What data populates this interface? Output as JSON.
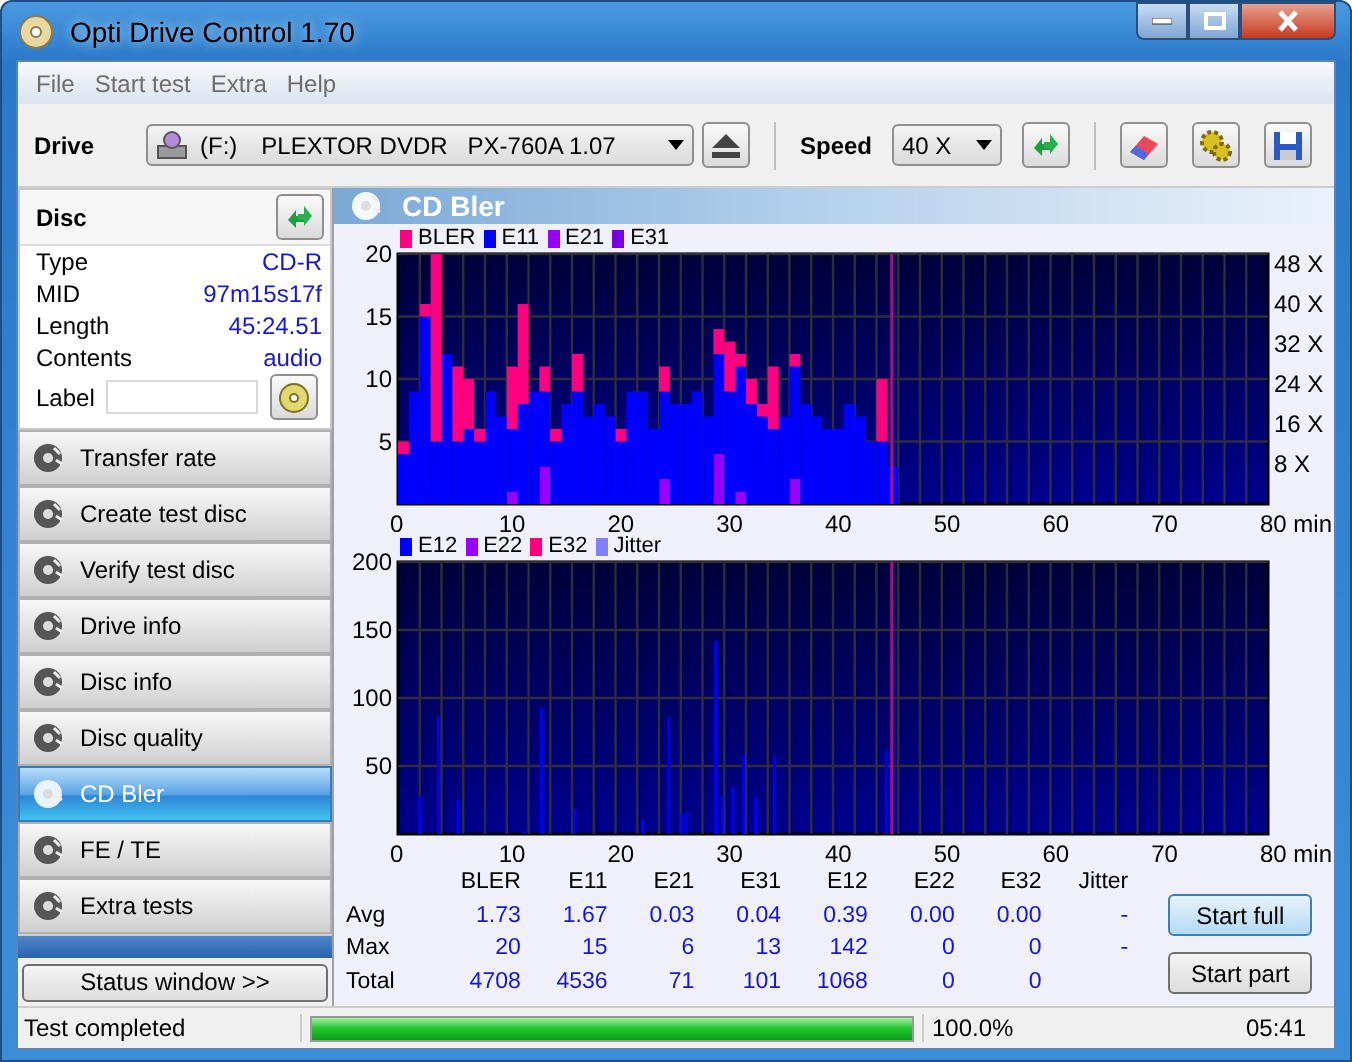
{
  "window": {
    "title": "Opti Drive Control 1.70"
  },
  "menu": [
    "File",
    "Start test",
    "Extra",
    "Help"
  ],
  "toolbar": {
    "drive_label": "Drive",
    "drive_letter": "(F:)",
    "drive_name": "PLEXTOR DVDR   PX-760A 1.07",
    "speed_label": "Speed",
    "speed": "40 X"
  },
  "disc": {
    "title": "Disc",
    "fields": [
      {
        "label": "Type",
        "value": "CD-R"
      },
      {
        "label": "MID",
        "value": "97m15s17f"
      },
      {
        "label": "Length",
        "value": "45:24.51"
      },
      {
        "label": "Contents",
        "value": "audio"
      }
    ],
    "label_caption": "Label"
  },
  "nav": [
    {
      "label": "Transfer rate",
      "selected": false
    },
    {
      "label": "Create test disc",
      "selected": false
    },
    {
      "label": "Verify test disc",
      "selected": false
    },
    {
      "label": "Drive info",
      "selected": false
    },
    {
      "label": "Disc info",
      "selected": false
    },
    {
      "label": "Disc quality",
      "selected": false
    },
    {
      "label": "CD Bler",
      "selected": true
    },
    {
      "label": "FE / TE",
      "selected": false
    },
    {
      "label": "Extra tests",
      "selected": false
    }
  ],
  "status_window_button": "Status window >>",
  "panel": {
    "title": "CD Bler",
    "top_chart": {
      "chart_data": {
        "type": "bar",
        "xlim": [
          0,
          80
        ],
        "ylim": [
          0,
          20
        ],
        "x": [
          0,
          1,
          2,
          3,
          4,
          5,
          6,
          7,
          8,
          9,
          10,
          11,
          12,
          13,
          14,
          15,
          16,
          17,
          18,
          19,
          20,
          21,
          22,
          23,
          24,
          25,
          26,
          27,
          28,
          29,
          30,
          31,
          32,
          33,
          34,
          35,
          36,
          37,
          38,
          39,
          40,
          41,
          42,
          43,
          44,
          45
        ],
        "series": [
          {
            "name": "BLER",
            "color": "#ff0080",
            "values": [
              1,
              0,
              1,
              15,
              0,
              6,
              4,
              1,
              0,
              0,
              5,
              8,
              0,
              2,
              1,
              0,
              3,
              0,
              0,
              0,
              1,
              0,
              0,
              0,
              2,
              0,
              0,
              0,
              0,
              2,
              4,
              1,
              2,
              1,
              5,
              0,
              1,
              0,
              0,
              0,
              0,
              0,
              0,
              0,
              5,
              0
            ]
          },
          {
            "name": "E11",
            "color": "#0000ff",
            "values": [
              4,
              9,
              15,
              5,
              12,
              5,
              6,
              5,
              9,
              7,
              5,
              8,
              9,
              6,
              5,
              8,
              9,
              7,
              8,
              7,
              5,
              9,
              9,
              6,
              7,
              8,
              8,
              9,
              7,
              8,
              9,
              10,
              8,
              7,
              6,
              7,
              9,
              8,
              7,
              6,
              6,
              8,
              7,
              5,
              5,
              3
            ]
          },
          {
            "name": "E21",
            "color": "#9900ff",
            "values": [
              0,
              0,
              0,
              0,
              0,
              0,
              0,
              0,
              0,
              0,
              1,
              0,
              0,
              3,
              0,
              0,
              0,
              0,
              0,
              0,
              0,
              0,
              0,
              0,
              2,
              0,
              0,
              0,
              0,
              4,
              0,
              1,
              0,
              0,
              0,
              0,
              2,
              0,
              0,
              0,
              0,
              0,
              0,
              0,
              0,
              0
            ]
          },
          {
            "name": "E31",
            "color": "#7a00e0",
            "values": [
              0,
              0,
              0,
              0,
              0,
              0,
              0,
              0,
              0,
              0,
              0,
              0,
              0,
              0,
              0,
              0,
              0,
              0,
              0,
              0,
              0,
              0,
              0,
              0,
              0,
              0,
              0,
              0,
              0,
              0,
              0,
              0,
              0,
              0,
              0,
              0,
              0,
              0,
              0,
              0,
              0,
              0,
              0,
              0,
              0,
              0
            ]
          }
        ],
        "stacked": true,
        "grid": true,
        "y2lim": [
          0,
          50
        ],
        "xticks": [
          0,
          10,
          20,
          30,
          40,
          50,
          60,
          70,
          {
            "value": 80,
            "label": "80 min"
          }
        ],
        "yticks": [
          5,
          10,
          15,
          20
        ],
        "y2ticks": [
          {
            "value": 8,
            "label": "8 X"
          },
          {
            "value": 16,
            "label": "16 X"
          },
          {
            "value": 24,
            "label": "24 X"
          },
          {
            "value": 32,
            "label": "32 X"
          },
          {
            "value": 40,
            "label": "40 X"
          },
          {
            "value": 48,
            "label": "48 X"
          }
        ],
        "ref_lines": [
          {
            "axis": "x",
            "value": 45.4,
            "color": "#a0108a"
          }
        ]
      }
    },
    "bottom_chart": {
      "chart_data": {
        "type": "bar",
        "xlim": [
          0,
          80
        ],
        "ylim": [
          0,
          200
        ],
        "x": [
          2,
          3.7,
          5.5,
          11.6,
          13.2,
          16.2,
          22.5,
          24.9,
          26.1,
          26.5,
          29.2,
          29.8,
          30.8,
          31.8,
          32.9,
          34.6,
          44.9
        ],
        "series": [
          {
            "name": "E12",
            "color": "#0000ff",
            "values": [
              28,
              86,
              25,
              2,
              93,
              18,
              10,
              86,
              15,
              16,
              142,
              28,
              34,
              58,
              26,
              58,
              62
            ]
          },
          {
            "name": "E22",
            "color": "#9900ff",
            "values": [
              0,
              0,
              0,
              0,
              0,
              0,
              0,
              0,
              0,
              0,
              0,
              0,
              0,
              0,
              0,
              0,
              0
            ]
          },
          {
            "name": "E32",
            "color": "#ff0080",
            "values": [
              0,
              0,
              0,
              0,
              0,
              0,
              0,
              0,
              0,
              0,
              0,
              0,
              0,
              0,
              0,
              0,
              0
            ]
          },
          {
            "name": "Jitter",
            "color": "#8080ff",
            "values": [
              null,
              null,
              null,
              null,
              null,
              null,
              null,
              null,
              null,
              null,
              null,
              null,
              null,
              null,
              null,
              null,
              null
            ]
          }
        ],
        "grid": true,
        "xticks": [
          0,
          10,
          20,
          30,
          40,
          50,
          60,
          70,
          {
            "value": 80,
            "label": "80 min"
          }
        ],
        "yticks": [
          50,
          100,
          150,
          200
        ],
        "ref_lines": [
          {
            "axis": "x",
            "value": 45.4,
            "color": "#a0108a"
          }
        ]
      }
    },
    "stats": {
      "columns": [
        "BLER",
        "E11",
        "E21",
        "E31",
        "E12",
        "E22",
        "E32",
        "Jitter"
      ],
      "rows": [
        {
          "label": "Avg",
          "cells": [
            "1.73",
            "1.67",
            "0.03",
            "0.04",
            "0.39",
            "0.00",
            "0.00",
            "-"
          ]
        },
        {
          "label": "Max",
          "cells": [
            "20",
            "15",
            "6",
            "13",
            "142",
            "0",
            "0",
            "-"
          ]
        },
        {
          "label": "Total",
          "cells": [
            "4708",
            "4536",
            "71",
            "101",
            "1068",
            "0",
            "0"
          ]
        }
      ]
    },
    "buttons": [
      "Start full",
      "Start part"
    ]
  },
  "status_bar": {
    "message": "Test completed",
    "progress": {
      "level": 1.0
    },
    "percent": "100.0%",
    "time": "05:41"
  }
}
